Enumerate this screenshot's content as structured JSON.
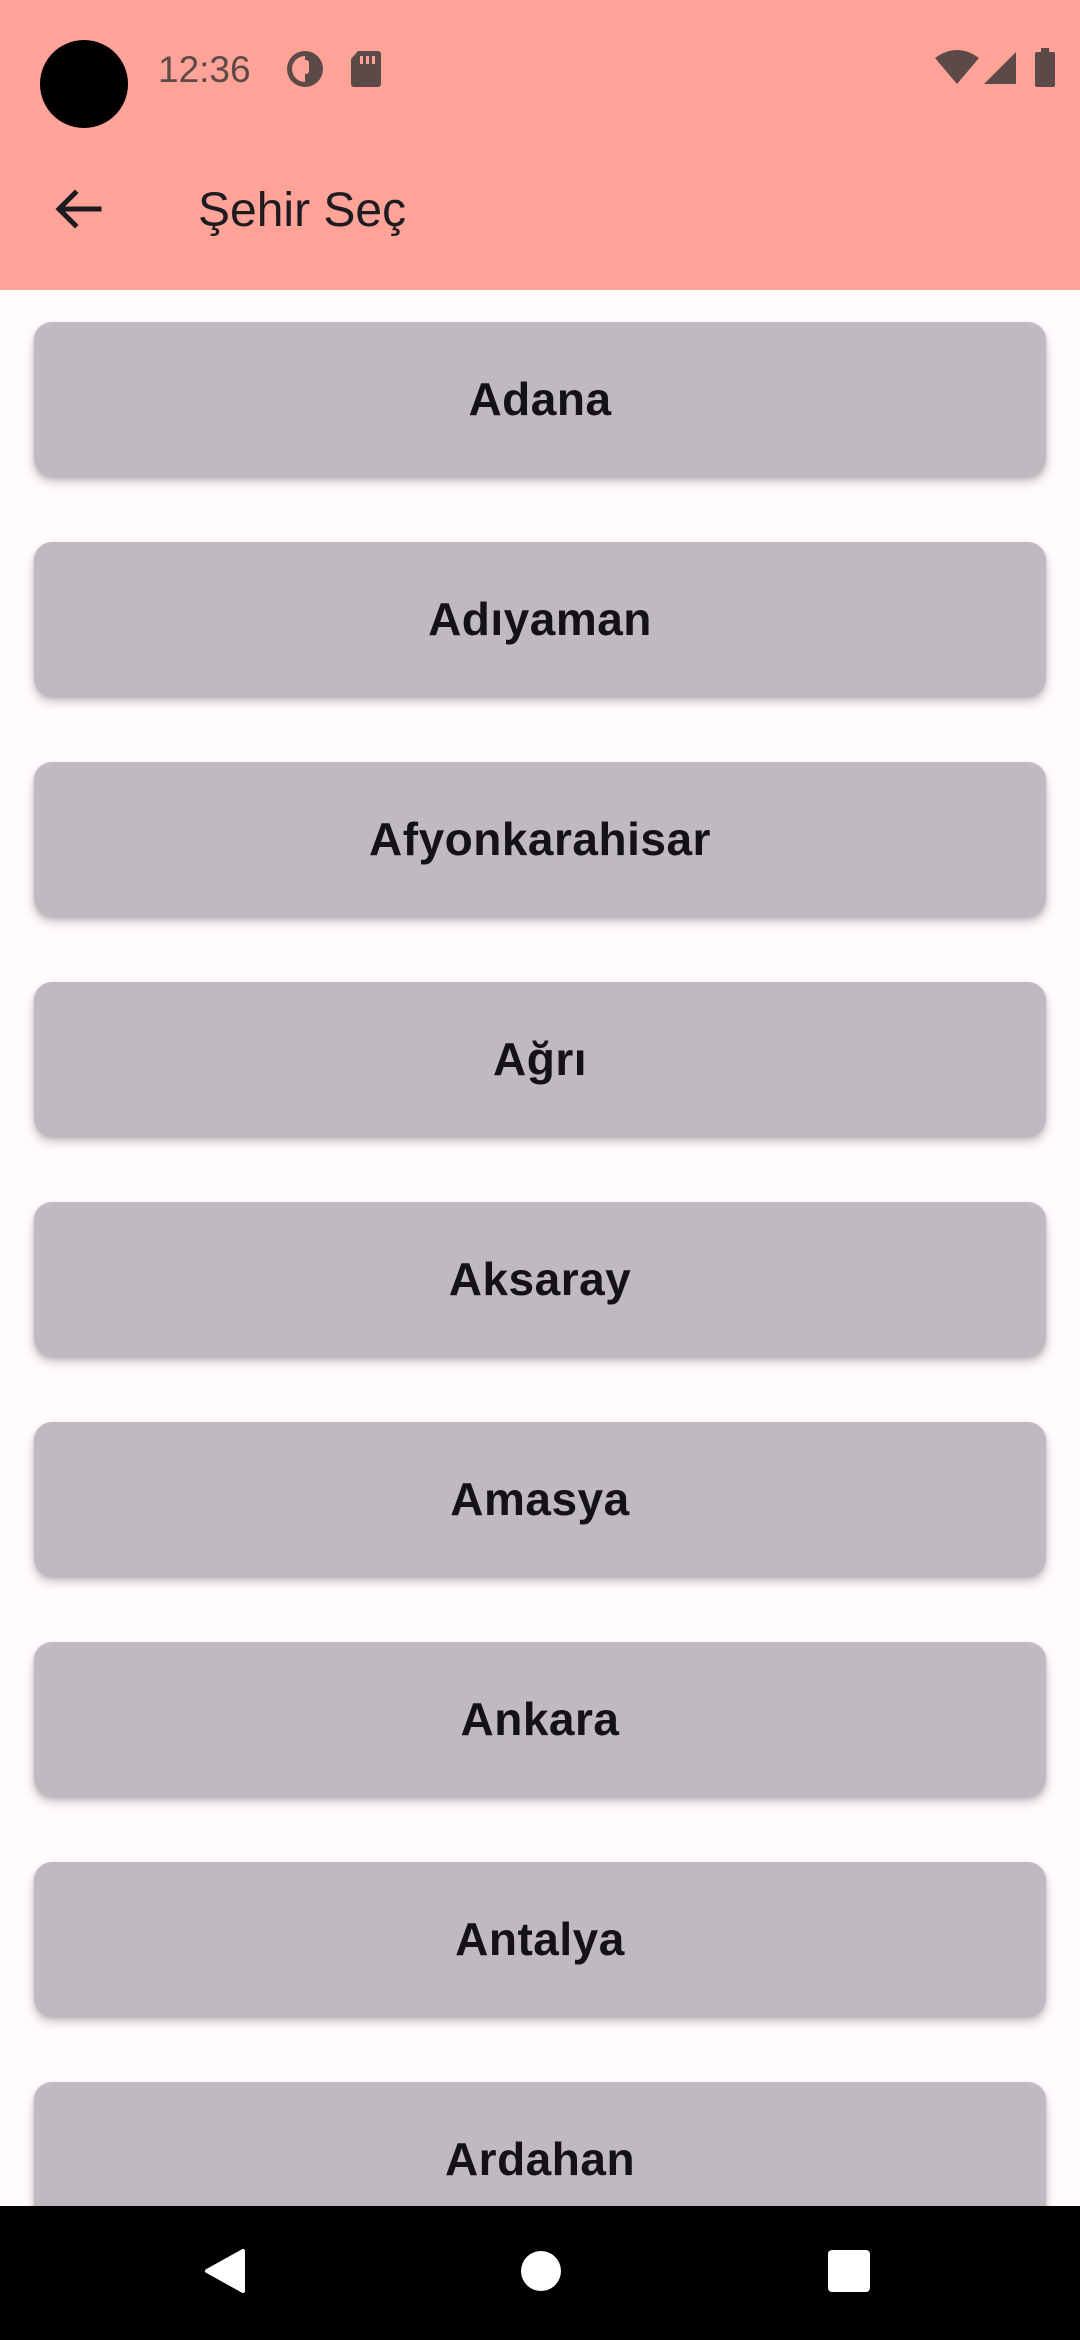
{
  "status_bar": {
    "time": "12:36",
    "left_icons": [
      "notification-app-icon",
      "sd-card-icon"
    ],
    "right_icons": [
      "wifi-icon",
      "cellular-signal-icon",
      "battery-icon"
    ]
  },
  "app_bar": {
    "title": "Şehir Seç",
    "back_icon": "arrow-back-icon",
    "background_color": "#FFA297"
  },
  "cities": [
    "Adana",
    "Adıyaman",
    "Afyonkarahisar",
    "Ağrı",
    "Aksaray",
    "Amasya",
    "Ankara",
    "Antalya",
    "Ardahan"
  ],
  "colors": {
    "button_background": "#BEBABF",
    "page_background": "#FFFBFE",
    "text": "#141218"
  },
  "nav_bar": {
    "buttons": [
      "back-triangle-icon",
      "home-circle-icon",
      "recents-square-icon"
    ]
  }
}
